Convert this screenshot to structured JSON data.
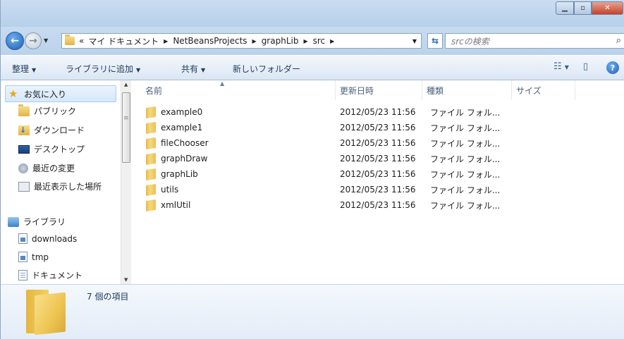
{
  "window": {
    "controls": {
      "minimize_icon": "minimize-icon",
      "maximize_icon": "maximize-icon",
      "close_icon": "close-icon"
    }
  },
  "address": {
    "overflow": "«",
    "crumbs": [
      "マイ ドキュメント",
      "NetBeansProjects",
      "graphLib",
      "src"
    ],
    "search_placeholder": "srcの検索"
  },
  "toolbar": {
    "organize": "整理",
    "add_to_library": "ライブラリに追加",
    "share": "共有",
    "new_folder": "新しいフォルダー"
  },
  "nav": {
    "favorites": "お気に入り",
    "public": "パブリック",
    "downloads_jp": "ダウンロード",
    "desktop": "デスクトップ",
    "recent_changes": "最近の変更",
    "recent_places": "最近表示した場所",
    "libraries": "ライブラリ",
    "lib_downloads": "downloads",
    "lib_tmp": "tmp",
    "documents": "ドキュメント"
  },
  "columns": {
    "name": "名前",
    "date": "更新日時",
    "type": "種類",
    "size": "サイズ"
  },
  "files": [
    {
      "name": "example0",
      "date": "2012/05/23 11:56",
      "type": "ファイル フォル..."
    },
    {
      "name": "example1",
      "date": "2012/05/23 11:56",
      "type": "ファイル フォル..."
    },
    {
      "name": "fileChooser",
      "date": "2012/05/23 11:56",
      "type": "ファイル フォル..."
    },
    {
      "name": "graphDraw",
      "date": "2012/05/23 11:56",
      "type": "ファイル フォル..."
    },
    {
      "name": "graphLib",
      "date": "2012/05/23 11:56",
      "type": "ファイル フォル..."
    },
    {
      "name": "utils",
      "date": "2012/05/23 11:56",
      "type": "ファイル フォル..."
    },
    {
      "name": "xmlUtil",
      "date": "2012/05/23 11:56",
      "type": "ファイル フォル..."
    }
  ],
  "details": {
    "count": "7 個の項目"
  },
  "colors": {
    "titlebar": "#c9dcf1",
    "toolbar_text": "#1e395b",
    "close": "#c3432b"
  }
}
